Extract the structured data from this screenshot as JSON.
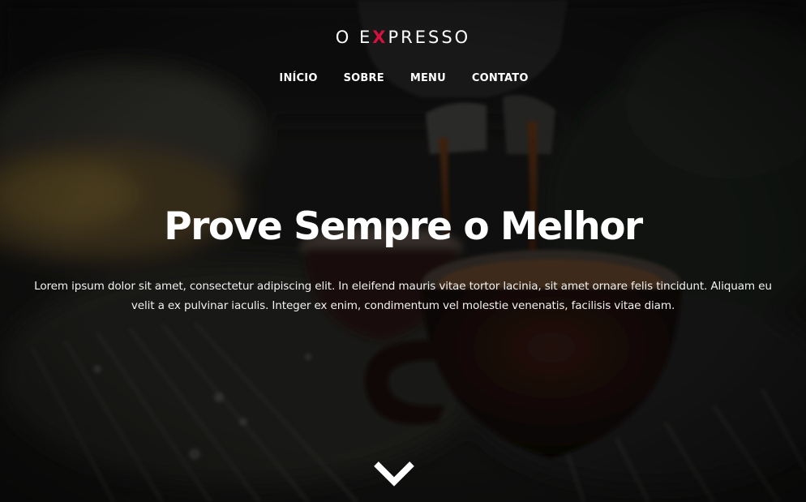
{
  "brand": {
    "prefix": "O E",
    "accent_letter": "X",
    "suffix": "PRESSO",
    "accent_color": "#d5123f"
  },
  "nav": {
    "items": [
      {
        "label": "INÍCIO"
      },
      {
        "label": "SOBRE"
      },
      {
        "label": "MENU"
      },
      {
        "label": "CONTATO"
      }
    ]
  },
  "hero": {
    "title": "Prove Sempre o Melhor",
    "description": "Lorem ipsum dolor sit amet, consectetur adipiscing elit. In eleifend mauris vitae tortor lacinia, sit amet ornare felis tincidunt. Aliquam eu velit a ex pulvinar iaculis. Integer ex enim, condimentum vel molestie venenatis, facilisis vitae diam.",
    "scroll_icon": "chevron-down-icon"
  }
}
